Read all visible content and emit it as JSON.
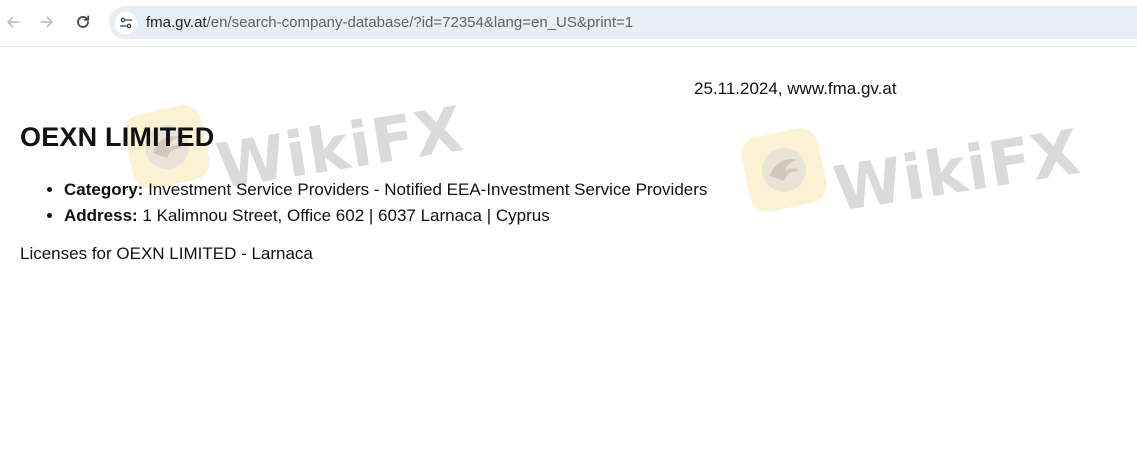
{
  "browser": {
    "url_host": "fma.gv.at",
    "url_path": "/en/search-company-database/?id=72354&lang=en_US&print=1"
  },
  "page": {
    "print_header": "25.11.2024, www.fma.gv.at",
    "company_title": "OEXN LIMITED",
    "info": [
      {
        "label": "Category:",
        "value": " Investment Service Providers - Notified EEA-Investment Service Providers"
      },
      {
        "label": "Address:",
        "value": " 1 Kalimnou Street, Office 602 |  6037  Larnaca  | Cyprus"
      }
    ],
    "licenses_text": "Licenses for OEXN LIMITED - Larnaca"
  },
  "watermark": {
    "brand_text": "WikiFX",
    "logo_color": "#fbf1cf",
    "text_color": "#d6d6d6"
  },
  "icons": [
    "back-arrow-icon",
    "forward-arrow-icon",
    "reload-icon",
    "site-info-icon",
    "wikifx-logo-icon"
  ]
}
